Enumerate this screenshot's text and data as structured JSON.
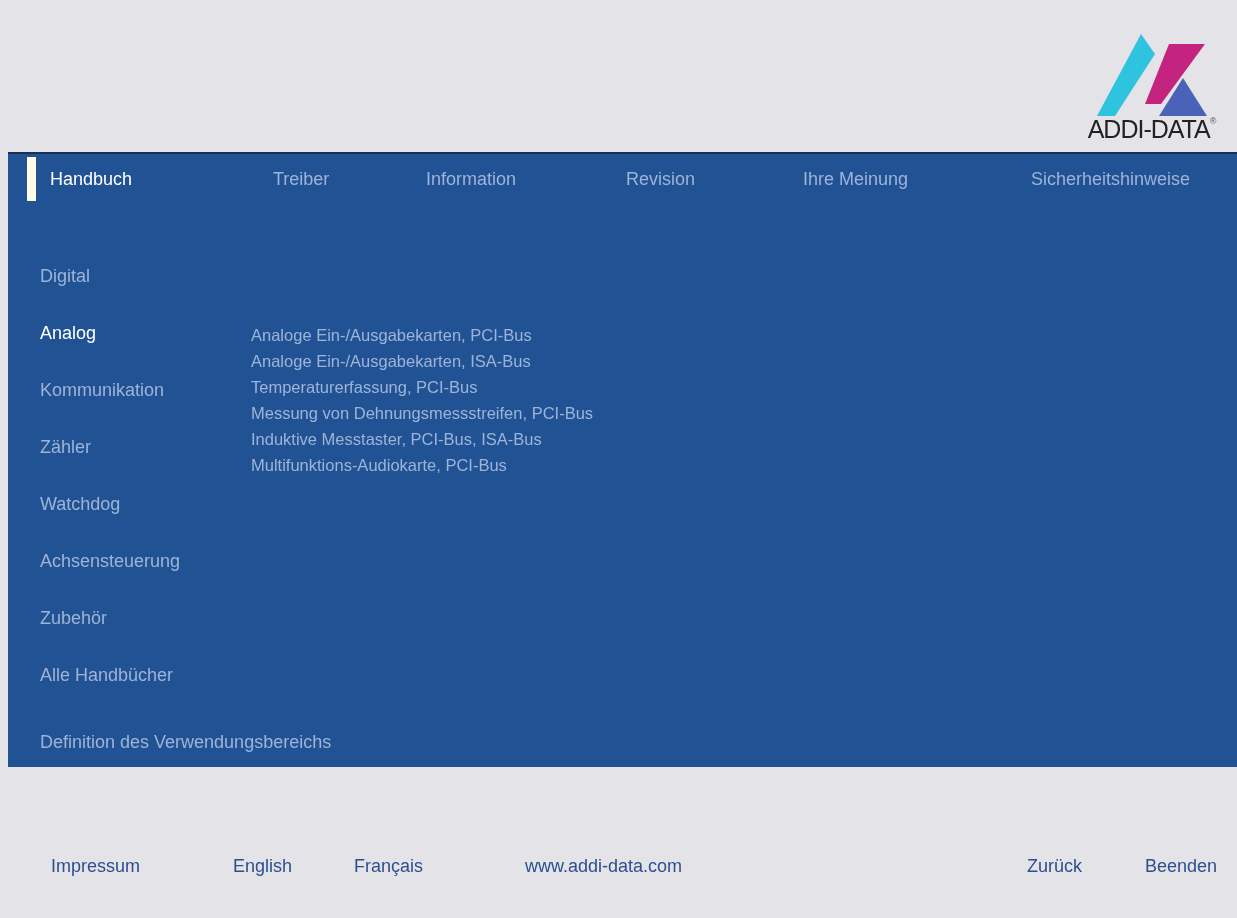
{
  "logo": {
    "text": "ADDI-DATA",
    "mark": "®"
  },
  "tabs": [
    {
      "label": "Handbuch",
      "selected": true
    },
    {
      "label": "Treiber",
      "selected": false
    },
    {
      "label": "Information",
      "selected": false
    },
    {
      "label": "Revision",
      "selected": false
    },
    {
      "label": "Ihre Meinung",
      "selected": false
    },
    {
      "label": "Sicherheitshinweise",
      "selected": false
    }
  ],
  "categories": [
    {
      "label": "Digital",
      "selected": false
    },
    {
      "label": "Analog",
      "selected": true,
      "children": [
        "Analoge Ein-/Ausgabekarten, PCI-Bus",
        "Analoge Ein-/Ausgabekarten, ISA-Bus",
        "Temperaturerfassung, PCI-Bus",
        "Messung von Dehnungsmessstreifen, PCI-Bus",
        "Induktive Messtaster, PCI-Bus, ISA-Bus",
        "Multifunktions-Audiokarte, PCI-Bus"
      ]
    },
    {
      "label": "Kommunikation",
      "selected": false
    },
    {
      "label": "Zähler",
      "selected": false
    },
    {
      "label": "Watchdog",
      "selected": false
    },
    {
      "label": "Achsensteuerung",
      "selected": false
    },
    {
      "label": "Zubehör",
      "selected": false
    },
    {
      "label": "Alle Handbücher",
      "selected": false
    }
  ],
  "definition_link": "Definition des Verwendungsbereichs",
  "footer_left": [
    "Impressum",
    "English",
    "Français",
    "www.addi-data.com"
  ],
  "footer_right": [
    "Zurück",
    "Beenden"
  ]
}
